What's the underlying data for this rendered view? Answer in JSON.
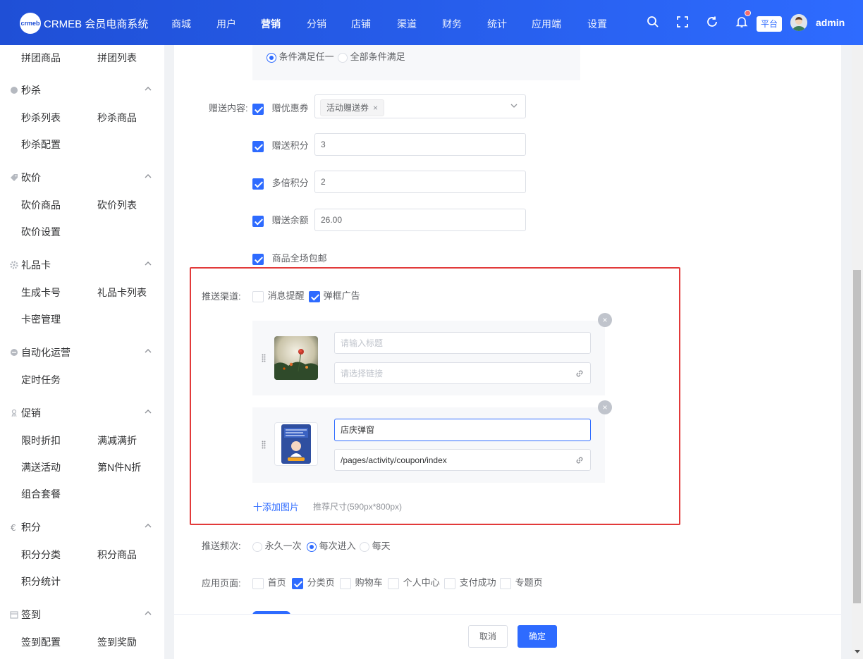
{
  "header": {
    "logo_mark": "crmeb",
    "app_title": "CRMEB 会员电商系统",
    "nav": [
      "商城",
      "用户",
      "营销",
      "分销",
      "店铺",
      "渠道",
      "财务",
      "统计",
      "应用端",
      "设置"
    ],
    "active_nav": "营销",
    "platform_label": "平台",
    "user_name": "admin"
  },
  "sidebar": {
    "top_items": [
      "拼团商品",
      "拼团列表"
    ],
    "groups": [
      {
        "title": "秒杀",
        "icon": "seckill-icon",
        "items": [
          "秒杀列表",
          "秒杀商品",
          "秒杀配置"
        ]
      },
      {
        "title": "砍价",
        "icon": "tag-icon",
        "items": [
          "砍价商品",
          "砍价列表",
          "砍价设置"
        ]
      },
      {
        "title": "礼品卡",
        "icon": "gear-icon",
        "items": [
          "生成卡号",
          "礼品卡列表",
          "卡密管理"
        ]
      },
      {
        "title": "自动化运营",
        "icon": "automation-icon",
        "items": [
          "定时任务"
        ]
      },
      {
        "title": "促销",
        "icon": "promotion-icon",
        "items": [
          "限时折扣",
          "满减满折",
          "满送活动",
          "第N件N折",
          "组合套餐"
        ]
      },
      {
        "title": "积分",
        "icon": "euro-icon",
        "items": [
          "积分分类",
          "积分商品",
          "积分统计"
        ]
      },
      {
        "title": "签到",
        "icon": "calendar-icon",
        "items": [
          "签到配置",
          "签到奖励"
        ]
      }
    ]
  },
  "form": {
    "condition": {
      "options": [
        "条件满足任一",
        "全部条件满足"
      ],
      "selected": 0
    },
    "gift_label": "赠送内容:",
    "gift_coupon": {
      "label": "赠优惠券",
      "checked": true,
      "tag": "活动赠送券",
      "tag_close": "×"
    },
    "gift_points": {
      "label": "赠送积分",
      "checked": true,
      "value": "3"
    },
    "multi_points": {
      "label": "多倍积分",
      "checked": true,
      "value": "2"
    },
    "gift_balance": {
      "label": "赠送余额",
      "checked": true,
      "value": "26.00"
    },
    "free_shipping": {
      "label": "商品全场包邮",
      "checked": true
    },
    "channel": {
      "label": "推送渠道:",
      "options": [
        {
          "label": "消息提醒",
          "checked": false
        },
        {
          "label": "弹框广告",
          "checked": true
        }
      ]
    },
    "popup_images": [
      {
        "title_placeholder": "请输入标题",
        "title_value": "",
        "link_placeholder": "请选择链接",
        "link_value": ""
      },
      {
        "title_placeholder": "请输入标题",
        "title_value": "店庆弹窗",
        "link_placeholder": "请选择链接",
        "link_value": "/pages/activity/coupon/index"
      }
    ],
    "remove_symbol": "×",
    "add_image_label": "十添加图片",
    "size_hint": "推荐尺寸(590px*800px)",
    "frequency": {
      "label": "推送频次:",
      "options": [
        "永久一次",
        "每次进入",
        "每天"
      ],
      "selected": 1
    },
    "pages": {
      "label": "应用页面:",
      "options": [
        {
          "label": "首页",
          "checked": false
        },
        {
          "label": "分类页",
          "checked": true
        },
        {
          "label": "购物车",
          "checked": false
        },
        {
          "label": "个人中心",
          "checked": false
        },
        {
          "label": "支付成功",
          "checked": false
        },
        {
          "label": "专题页",
          "checked": false
        }
      ]
    }
  },
  "footer": {
    "cancel_label": "取消",
    "confirm_label": "确定"
  },
  "colors": {
    "primary": "#2e6bff",
    "highlight_border": "#e23a3a",
    "notify_dot": "#f56c6c"
  }
}
